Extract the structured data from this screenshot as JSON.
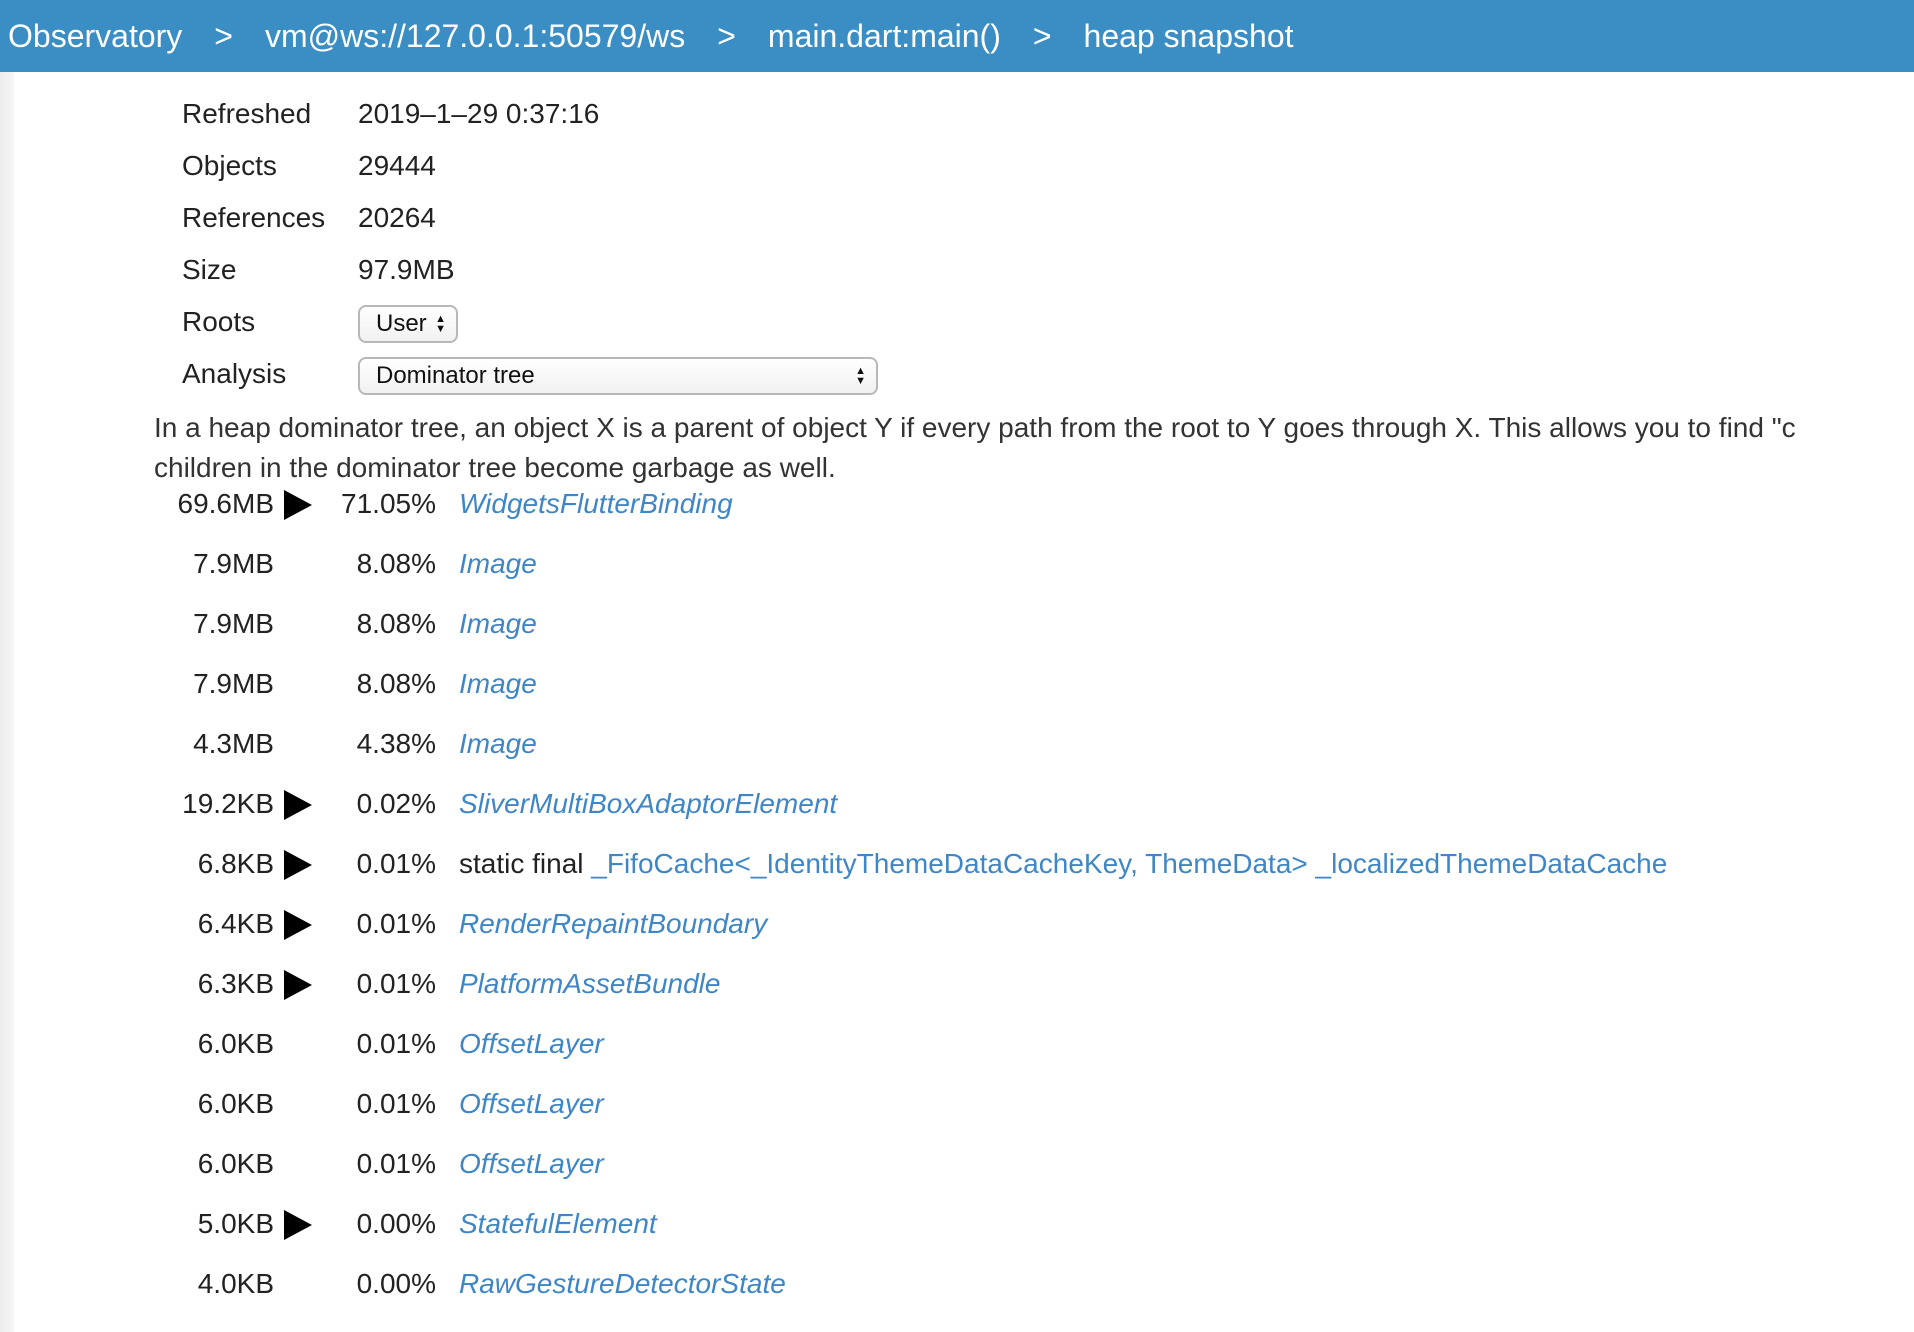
{
  "breadcrumb": [
    {
      "label": "Observatory",
      "separator": ">"
    },
    {
      "label": "vm@ws://127.0.0.1:50579/ws",
      "separator": ">"
    },
    {
      "label": "main.dart:main()",
      "separator": ">"
    },
    {
      "label": "heap snapshot"
    }
  ],
  "info": {
    "refreshed_label": "Refreshed",
    "refreshed_value": "2019–1–29 0:37:16",
    "objects_label": "Objects",
    "objects_value": "29444",
    "references_label": "References",
    "references_value": "20264",
    "size_label": "Size",
    "size_value": "97.9MB",
    "roots_label": "Roots",
    "roots_value": "User",
    "analysis_label": "Analysis",
    "analysis_value": "Dominator tree"
  },
  "description": {
    "line1": "In a heap dominator tree, an object X is a parent of object Y if every path from the root to Y goes through X. This allows you to find \"c",
    "line2": "children in the dominator tree become garbage as well."
  },
  "tree_rows": [
    {
      "size": "69.6MB",
      "expandable": true,
      "percent": "71.05%",
      "object": "WidgetsFlutterBinding"
    },
    {
      "size": "7.9MB",
      "expandable": false,
      "percent": "8.08%",
      "object": "Image"
    },
    {
      "size": "7.9MB",
      "expandable": false,
      "percent": "8.08%",
      "object": "Image"
    },
    {
      "size": "7.9MB",
      "expandable": false,
      "percent": "8.08%",
      "object": "Image"
    },
    {
      "size": "4.3MB",
      "expandable": false,
      "percent": "4.38%",
      "object": "Image"
    },
    {
      "size": "19.2KB",
      "expandable": true,
      "percent": "0.02%",
      "object": "SliverMultiBoxAdaptorElement"
    },
    {
      "size": "6.8KB",
      "expandable": true,
      "percent": "0.01%",
      "prefix": "static final ",
      "field": "_FifoCache<_IdentityThemeDataCacheKey, ThemeData> _localizedThemeDataCache"
    },
    {
      "size": "6.4KB",
      "expandable": true,
      "percent": "0.01%",
      "object": "RenderRepaintBoundary"
    },
    {
      "size": "6.3KB",
      "expandable": true,
      "percent": "0.01%",
      "object": "PlatformAssetBundle"
    },
    {
      "size": "6.0KB",
      "expandable": false,
      "percent": "0.01%",
      "object": "OffsetLayer"
    },
    {
      "size": "6.0KB",
      "expandable": false,
      "percent": "0.01%",
      "object": "OffsetLayer"
    },
    {
      "size": "6.0KB",
      "expandable": false,
      "percent": "0.01%",
      "object": "OffsetLayer"
    },
    {
      "size": "5.0KB",
      "expandable": true,
      "percent": "0.00%",
      "object": "StatefulElement"
    },
    {
      "size": "4.0KB",
      "expandable": false,
      "percent": "0.00%",
      "object": "RawGestureDetectorState"
    }
  ],
  "colors": {
    "topbar": "#3a8ec4",
    "link": "#3f86c7"
  }
}
